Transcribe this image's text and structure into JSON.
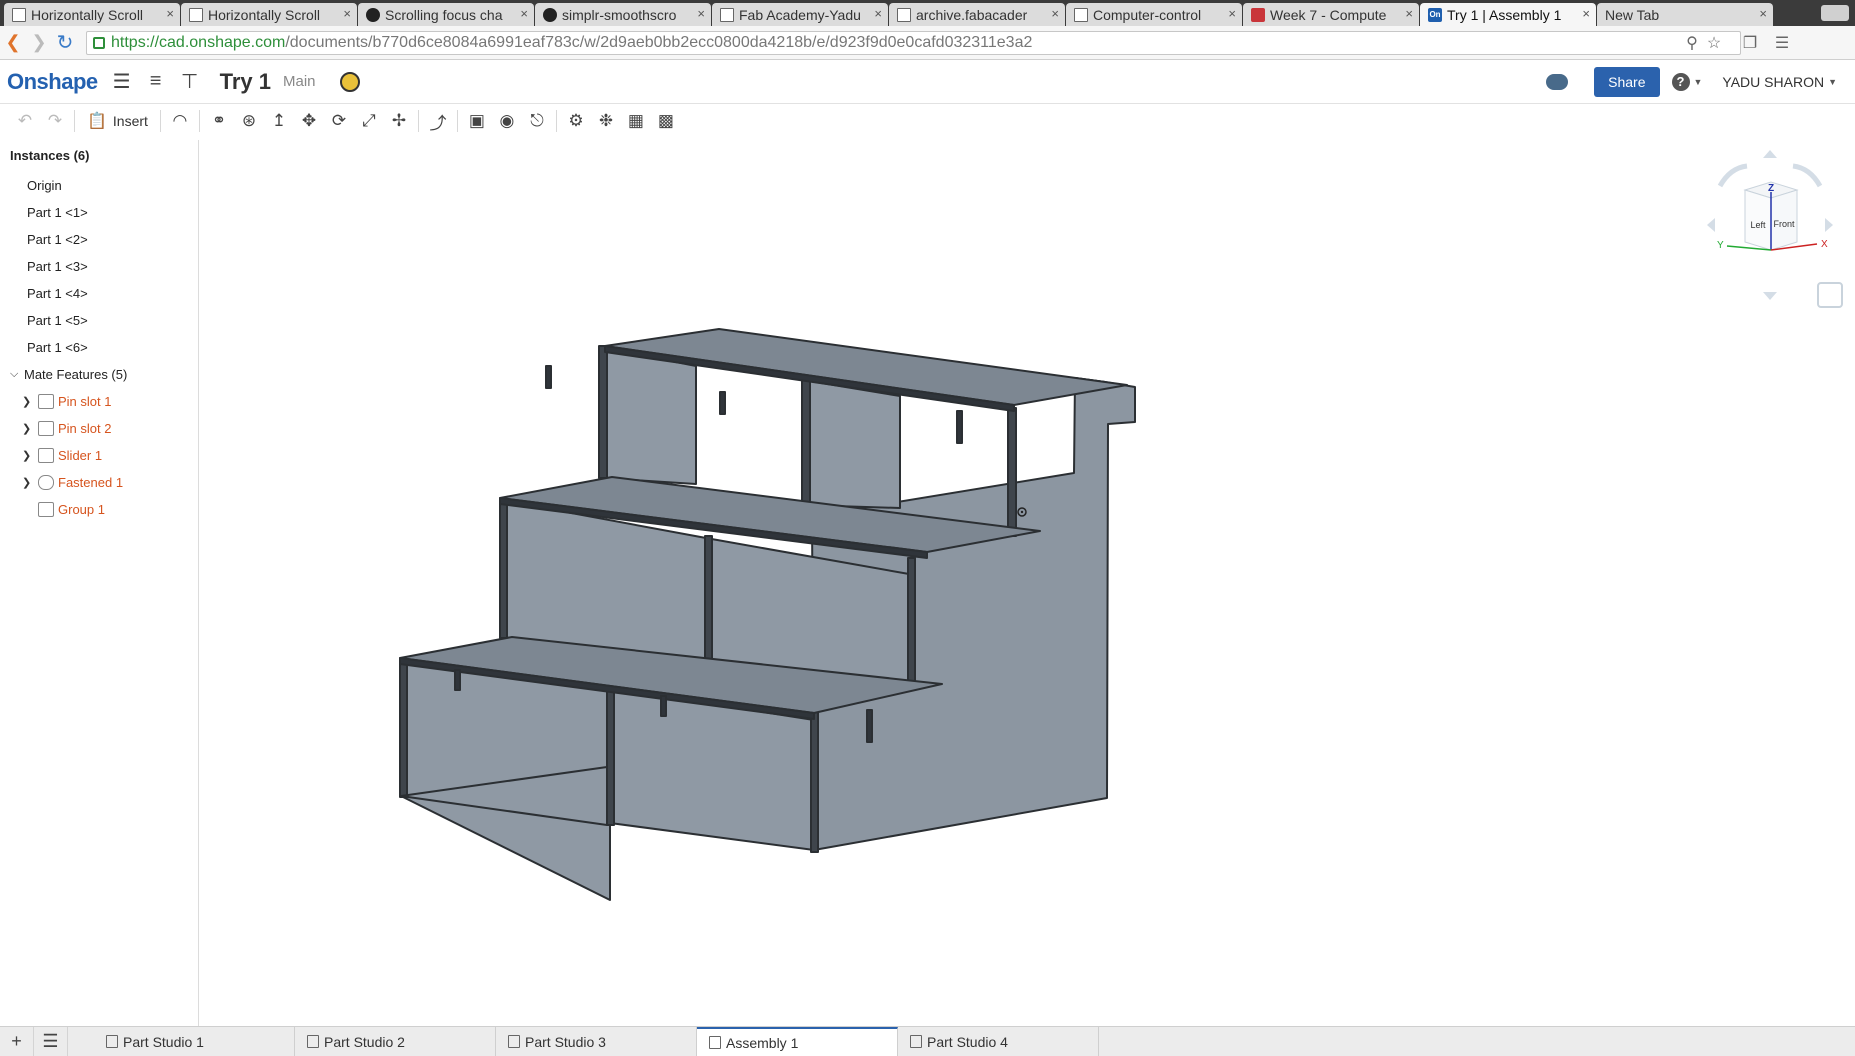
{
  "browser": {
    "tabs": [
      {
        "title": "Horizontally Scroll",
        "icon": "doc-icon",
        "active": false
      },
      {
        "title": "Horizontally Scroll",
        "icon": "doc-icon",
        "active": false
      },
      {
        "title": "Scrolling focus cha",
        "icon": "github-icon",
        "active": false
      },
      {
        "title": "simplr-smoothscro",
        "icon": "github-icon",
        "active": false
      },
      {
        "title": "Fab Academy-Yadu",
        "icon": "doc-icon",
        "active": false
      },
      {
        "title": "archive.fabacader",
        "icon": "doc-icon",
        "active": false
      },
      {
        "title": "Computer-control",
        "icon": "doc-icon",
        "active": false
      },
      {
        "title": "Week 7 - Compute",
        "icon": "cube-icon",
        "active": false
      },
      {
        "title": "Try 1 | Assembly 1",
        "icon": "onshape-icon",
        "active": true
      },
      {
        "title": "New Tab",
        "icon": "none",
        "active": false
      }
    ],
    "tab_close_glyph": "×",
    "url_host": "https://cad.onshape.com",
    "url_path": "/documents/b770d6ce8084a6991eaf783c/w/2d9aeb0bb2ecc0800da4218b/e/d923f9d0e0cafd032311e3a2"
  },
  "app": {
    "logo": "Onshape",
    "onshape_favicon": "On",
    "doc_title": "Try 1",
    "workspace": "Main",
    "share_label": "Share",
    "help_glyph": "?",
    "user": "YADU SHARON",
    "insert_label": "Insert"
  },
  "tree": {
    "instances_header": "Instances (6)",
    "instances": [
      "Origin",
      "Part 1 <1>",
      "Part 1 <2>",
      "Part 1 <3>",
      "Part 1 <4>",
      "Part 1 <5>",
      "Part 1 <6>"
    ],
    "mates_header": "Mate Features (5)",
    "mates": [
      {
        "label": "Pin slot 1",
        "icon": "pin-slot-icon"
      },
      {
        "label": "Pin slot 2",
        "icon": "pin-slot-icon"
      },
      {
        "label": "Slider 1",
        "icon": "slider-icon"
      },
      {
        "label": "Fastened 1",
        "icon": "fastened-icon"
      },
      {
        "label": "Group 1",
        "icon": "group-icon"
      }
    ]
  },
  "viewcube": {
    "top": "Z",
    "left": "Left",
    "front": "Front",
    "x_axis": "X",
    "y_axis": "Y"
  },
  "bottom_tabs": [
    {
      "label": "Part Studio 1",
      "active": false
    },
    {
      "label": "Part Studio 2",
      "active": false
    },
    {
      "label": "Part Studio 3",
      "active": false
    },
    {
      "label": "Assembly 1",
      "active": true
    },
    {
      "label": "Part Studio 4",
      "active": false
    }
  ],
  "colors": {
    "accent": "#2b62ad",
    "mate_text": "#d6541e",
    "part_face": "#8c96a1",
    "part_top": "#7d8792",
    "part_edge": "#2b2f33"
  }
}
